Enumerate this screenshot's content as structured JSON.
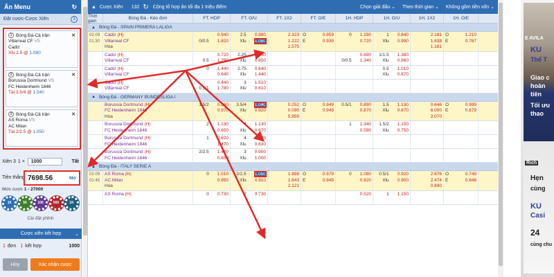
{
  "colors": {
    "brand": "#2f6db3",
    "highlight": "#e02a2a",
    "odds_red": "#c62020",
    "confirm": "#ef7c1c"
  },
  "left": {
    "menu_label": "Ẩn Menu",
    "slip_title": "Đặt cược-Cược Xiên",
    "slip_count": "3",
    "bets": [
      {
        "no": "1",
        "type": "Bóng Đá-Cả trận",
        "home": "Villarreal CF",
        "vs": "VS",
        "away": "Cadiz",
        "pick": "Xỉu 2.5",
        "odd": "1.080"
      },
      {
        "no": "2",
        "type": "Bóng Đá-Cả trận",
        "home": "Borussia Dortmund",
        "vs": "VS",
        "away": "FC Heidenheim 1846",
        "pick": "Tài 3.5/4",
        "odd": "1.040"
      },
      {
        "no": "3",
        "type": "Bóng Đá-Cả trận",
        "home": "AS Roma",
        "vs": "VS",
        "away": "AC Milan",
        "pick": "Tài 2/2.5",
        "odd": "1.050"
      }
    ],
    "xien_label": "Xiên 3",
    "xien_x": "1 ×",
    "xien_amount": "1000",
    "xien_all": "Tất",
    "win_label": "Tiền thắng",
    "win_value": "7698.56",
    "win_max": "Mở",
    "muc_label": "Mức cược",
    "muc_value": "1 - 27000",
    "chips": [
      "10",
      "50",
      "100",
      "500",
      "1K"
    ],
    "settings_label": "Cài đặt phỉnh",
    "combo_label": "Cược xiên kết hợp",
    "don_no": "1",
    "don_label": "đơn",
    "kethop_no": "1",
    "kethop_label": "kết hợp",
    "don_amount": "1000",
    "cancel_label": "Hủy",
    "confirm_label": "Xác nhận cược"
  },
  "main": {
    "title": "Cược Xiên",
    "count": "132",
    "msg": "Cộng tổ hợp ăn tối đa 1 triệu điểm",
    "filter1": "Chọn giải đấu",
    "filter2": "Theo thời gian",
    "filter3": "Không gồm tiền vốn",
    "headers": [
      "Thời gian",
      "Bóng Đá - Kèo đơn",
      "FT. HDP",
      "FT. O/U",
      "FT. 1X2",
      "FT. O/E",
      "1H. HDP",
      "1H. O/U",
      "1H. 1X2",
      "1H. O/E"
    ],
    "leagues": [
      {
        "name": "Bóng Đá - SPAIN PRIMERA LALIGA"
      },
      {
        "name": "Bóng Đá - GERMANY BUNDESLIGA I"
      },
      {
        "name": "Bóng Đá - ITALY SERIE A"
      }
    ]
  },
  "rows_spain": [
    {
      "date": "02-09",
      "time": "01:30",
      "home": "Cadiz",
      "away": "Villarreal CF",
      "draw": "Hòa",
      "hdp_l": [
        "",
        "0/0.5"
      ],
      "hdp_r": [
        "0.940",
        "1.820"
      ],
      "ou_l": [
        "2.5",
        "Xỉu"
      ],
      "ou_r": [
        "0.880",
        "1.080"
      ],
      "x12": [
        "2.323",
        "1.222",
        "2.575"
      ],
      "oe_l": [
        "O",
        "E"
      ],
      "oe_r": [
        "0.959",
        "0.939"
      ],
      "h1hdp_l": [
        "0",
        ""
      ],
      "h1hdp_r": [
        "1.290",
        "0.720"
      ],
      "h1ou_l": [
        "1",
        "Xỉu"
      ],
      "h1ou_r": [
        "0.840",
        "0.990"
      ],
      "h1x12": [
        "2.181",
        "1.838",
        "1.181"
      ],
      "h1oe_l": [
        "O",
        "E"
      ],
      "h1oe_r": [
        "1.210",
        "0.767"
      ]
    },
    {
      "date": "",
      "time": "",
      "home": "Cadiz",
      "away": "Villarreal CF",
      "draw": "",
      "hdp_l": [
        "",
        "0.5"
      ],
      "hdp_r": [
        "0.720",
        "1.290"
      ],
      "ou_l": [
        "2.25",
        "Xỉu"
      ],
      "ou_r": [
        "1.040",
        "0.850"
      ],
      "x12": [
        "",
        "",
        ""
      ],
      "oe_l": [
        "",
        ""
      ],
      "oe_r": [
        "",
        ""
      ],
      "h1hdp_l": [
        "",
        "0/0.5"
      ],
      "h1hdp_r": [
        "0.690",
        "1.340"
      ],
      "h1ou_l": [
        "1/1.5",
        "Xỉu"
      ],
      "h1ou_r": [
        "1.380",
        "0.660"
      ],
      "h1x12": [
        "",
        "",
        ""
      ],
      "h1oe_l": [
        "",
        ""
      ],
      "h1oe_r": [
        "",
        ""
      ]
    },
    {
      "date": "",
      "time": "",
      "home": "Cadiz",
      "away": "Villarreal CF",
      "draw": "",
      "hdp_l": [
        "0",
        ""
      ],
      "hdp_r": [
        "1.440",
        "0.640"
      ],
      "ou_l": [
        "2.75",
        "Xỉu"
      ],
      "ou_r": [
        "0.640",
        "1.440"
      ],
      "x12": [
        "",
        "",
        ""
      ],
      "oe_l": [
        "",
        ""
      ],
      "oe_r": [
        "",
        ""
      ],
      "h1hdp_l": [
        "",
        ""
      ],
      "h1hdp_r": [
        "",
        ""
      ],
      "h1ou_l": [
        "0.5",
        "Xỉu"
      ],
      "h1ou_r": [
        "1.010",
        "0.870"
      ],
      "h1x12": [
        "",
        "",
        ""
      ],
      "h1oe_l": [
        "",
        ""
      ],
      "h1oe_r": [
        "",
        ""
      ]
    },
    {
      "date": "",
      "time": "",
      "home": "Cadiz",
      "away": "Villarreal CF",
      "draw": "",
      "hdp_l": [
        "",
        "0.5/1"
      ],
      "hdp_r": [
        "0.440",
        "1.780"
      ],
      "ou_l": [
        "3",
        "Xỉu"
      ],
      "ou_r": [
        "1.510",
        "0.610"
      ],
      "x12": [
        "",
        "",
        ""
      ],
      "oe_l": [
        "",
        ""
      ],
      "oe_r": [
        "",
        ""
      ],
      "h1hdp_l": [
        "",
        ""
      ],
      "h1hdp_r": [
        "",
        ""
      ],
      "h1ou_l": [
        "",
        ""
      ],
      "h1ou_r": [
        "",
        ""
      ],
      "h1x12": [
        "",
        "",
        ""
      ],
      "h1oe_l": [
        "",
        ""
      ],
      "h1oe_r": [
        "",
        ""
      ]
    }
  ],
  "rows_germany": [
    {
      "date": "",
      "time": "",
      "home": "Borussia Dortmund",
      "away": "FC Heidenheim 1846",
      "draw": "Hòa",
      "hdp_l": [
        "1.5/2",
        ""
      ],
      "hdp_r": [
        "0.860",
        "0.970"
      ],
      "ou_l": [
        "3.5/4",
        "Xỉu"
      ],
      "ou_r": [
        "1.040",
        "0.920"
      ],
      "x12": [
        "0.252",
        "0.090",
        "5.959"
      ],
      "oe_l": [
        "O",
        "E"
      ],
      "oe_r": [
        "0.949",
        "0.949"
      ],
      "h1hdp_l": [
        "0.5/1",
        ""
      ],
      "h1hdp_r": [
        "0.890",
        "0.870"
      ],
      "h1ou_l": [
        "1.5",
        "Xỉu"
      ],
      "h1ou_r": [
        "1.130",
        "0.670"
      ],
      "h1x12": [
        "0.646",
        "6.000",
        "2.070"
      ],
      "h1oe_l": [
        "O",
        "E"
      ],
      "h1oe_r": [
        "0.999",
        "0.879"
      ]
    },
    {
      "date": "",
      "time": "",
      "home": "Borussia Dortmund",
      "away": "FC Heidenheim 1846",
      "draw": "",
      "hdp_l": [
        "2",
        ""
      ],
      "hdp_r": [
        "1.130",
        "0.650"
      ],
      "ou_l": [
        "4",
        "Xỉu"
      ],
      "ou_r": [
        "1.130",
        "0.670"
      ],
      "x12": [
        "",
        "",
        ""
      ],
      "oe_l": [
        "",
        ""
      ],
      "oe_r": [
        "",
        ""
      ],
      "h1hdp_l": [
        "1",
        ""
      ],
      "h1hdp_r": [
        "1.340",
        "0.590"
      ],
      "h1ou_l": [
        "1.5/2",
        "Xỉu"
      ],
      "h1ou_r": [
        "1.150",
        "0.750"
      ],
      "h1x12": [
        "",
        "",
        ""
      ],
      "h1oe_l": [
        "",
        ""
      ],
      "h1oe_r": [
        "",
        ""
      ]
    },
    {
      "date": "",
      "time": "",
      "home": "Borussia Dortmund",
      "away": "FC Heidenheim 1846",
      "draw": "",
      "hdp_l": [
        "1",
        ""
      ],
      "hdp_r": [
        "0.620",
        "1.470"
      ],
      "ou_l": [
        "4",
        "Xỉu"
      ],
      "ou_r": [
        "1.170",
        "0.630"
      ],
      "x12": [
        "",
        "",
        ""
      ],
      "oe_l": [
        "",
        ""
      ],
      "oe_r": [
        "",
        ""
      ],
      "h1hdp_l": [
        "",
        ""
      ],
      "h1hdp_r": [
        "",
        ""
      ],
      "h1ou_l": [
        "",
        ""
      ],
      "h1ou_r": [
        "",
        ""
      ],
      "h1x12": [
        "",
        "",
        ""
      ],
      "h1oe_l": [
        "",
        ""
      ],
      "h1oe_r": [
        "",
        ""
      ]
    },
    {
      "date": "",
      "time": "",
      "home": "Borussia Dortmund",
      "away": "FC Heidenheim 1846",
      "draw": "",
      "hdp_l": [
        "2/2.5",
        ""
      ],
      "hdp_r": [
        "1.420",
        "0.650"
      ],
      "ou_l": [
        "3",
        "Xỉu"
      ],
      "ou_r": [
        "0.900",
        "1.000"
      ],
      "x12": [
        "",
        "",
        ""
      ],
      "oe_l": [
        "",
        ""
      ],
      "oe_r": [
        "",
        ""
      ],
      "h1hdp_l": [
        "",
        ""
      ],
      "h1hdp_r": [
        "",
        ""
      ],
      "h1ou_l": [
        "",
        ""
      ],
      "h1ou_r": [
        "",
        ""
      ],
      "h1x12": [
        "",
        "",
        ""
      ],
      "h1oe_l": [
        "",
        ""
      ],
      "h1oe_r": [
        "",
        ""
      ]
    }
  ],
  "rows_italy": [
    {
      "date": "02-09",
      "time": "01:45",
      "home": "AS Roma",
      "away": "AC Milan",
      "draw": "Hòa",
      "hdp_l": [
        "0",
        ""
      ],
      "hdp_r": [
        "1.010",
        "0.950"
      ],
      "ou_l": [
        "2/2.5",
        "Xỉu"
      ],
      "ou_r": [
        "1.050",
        "0.910"
      ],
      "x12": [
        "1.888",
        "1.643",
        "2.121"
      ],
      "oe_l": [
        "O",
        "E"
      ],
      "oe_r": [
        "0.979",
        "0.949"
      ],
      "h1hdp_l": [
        "0",
        ""
      ],
      "h1hdp_r": [
        "1.080",
        "0.820"
      ],
      "h1ou_l": [
        "0.5/1",
        "Xỉu"
      ],
      "h1ou_r": [
        "0.920",
        "0.900"
      ],
      "h1x12": [
        "2.676",
        "2.474",
        "0.890"
      ],
      "h1oe_l": [
        "O",
        "E"
      ],
      "h1oe_r": [
        "0.749",
        "0.848"
      ]
    },
    {
      "date": "",
      "time": "",
      "home": "AS Roma",
      "away": "",
      "draw": "",
      "hdp_l": [
        "0",
        ""
      ],
      "hdp_r": [
        "0.730",
        ""
      ],
      "ou_l": [
        "2",
        ""
      ],
      "ou_r": [
        "0.730",
        ""
      ],
      "x12": [
        "",
        "",
        ""
      ],
      "oe_l": [
        "",
        ""
      ],
      "oe_r": [
        "",
        ""
      ],
      "h1hdp_l": [
        "",
        ""
      ],
      "h1hdp_r": [
        "0.520",
        ""
      ],
      "h1ou_l": [
        "1",
        ""
      ],
      "h1ou_r": [
        "1.150",
        ""
      ],
      "h1x12": [
        "",
        "",
        ""
      ],
      "h1oe_l": [
        "",
        ""
      ],
      "h1oe_r": [
        "",
        ""
      ]
    }
  ],
  "banner": {
    "tag": "E AVILA",
    "line1": "KU",
    "line2": "Thể T",
    "line3": "Giao c",
    "line4": "hoàn",
    "line5": "tiên",
    "line6": "Tối ưu",
    "line7": "thao",
    "line8": "Rich",
    "line9": "Hẹn",
    "line10": "cùng",
    "line11": "KU",
    "line12": "Casi",
    "line13": "24",
    "line14": "cùng chu"
  }
}
